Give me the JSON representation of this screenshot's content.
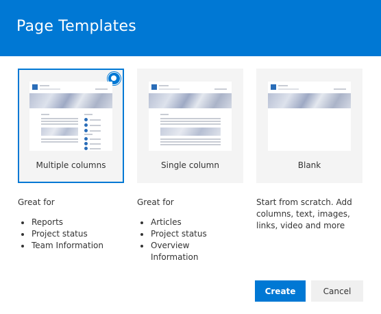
{
  "dialog": {
    "title": "Page Templates"
  },
  "templates": [
    {
      "label": "Multiple columns",
      "selected": true,
      "intro": "Great for",
      "bullets": [
        "Reports",
        "Project status",
        "Team Information"
      ]
    },
    {
      "label": "Single column",
      "selected": false,
      "intro": "Great for",
      "bullets": [
        "Articles",
        "Project status",
        "Overview Information"
      ]
    },
    {
      "label": "Blank",
      "selected": false,
      "intro": "Start from scratch. Add columns, text, images, links, video and more",
      "bullets": []
    }
  ],
  "buttons": {
    "create": "Create",
    "cancel": "Cancel"
  },
  "colors": {
    "accent": "#0078d4",
    "card_background": "#f4f4f4"
  }
}
